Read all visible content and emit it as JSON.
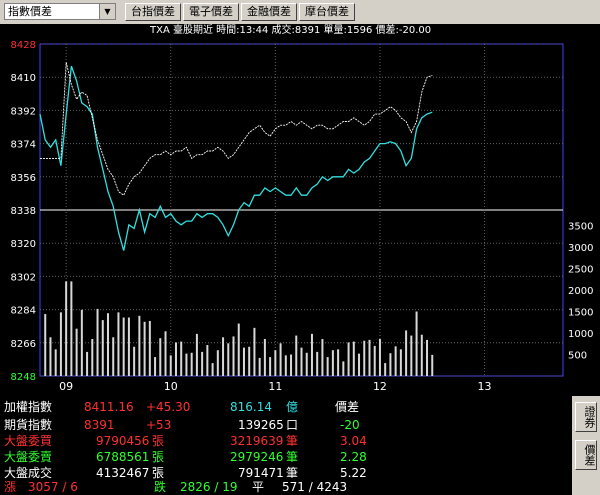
{
  "toolbar": {
    "selector_value": "指數價差",
    "buttons": [
      "台指價差",
      "電子價差",
      "金融價差",
      "摩台價差"
    ]
  },
  "chart": {
    "info_line": "TXA  臺股期近 時間:13:44 成交:8391 單量:1596 價差:-20.00",
    "colors": {
      "futures": "#30e0e0",
      "index": "#ffffff",
      "volume": "#d8d8d8",
      "grid": "#606060",
      "axis": "#4040ff"
    }
  },
  "chart_data": {
    "type": "line",
    "y_ticks": [
      "8428",
      "8410",
      "8392",
      "8374",
      "8356",
      "8338",
      "8320",
      "8302",
      "8284",
      "8266",
      "8248"
    ],
    "y_range": [
      8248,
      8428
    ],
    "reference_price": 8338,
    "volume_ticks": [
      "3500",
      "3000",
      "2500",
      "2000",
      "1500",
      "1000",
      "500"
    ],
    "volume_range": [
      0,
      4000
    ],
    "x_ticks": [
      "09",
      "10",
      "11",
      "12",
      "13"
    ],
    "session_minutes": [
      0,
      300
    ],
    "series": [
      {
        "name": "futures",
        "points": [
          [
            0,
            8390
          ],
          [
            3,
            8376
          ],
          [
            6,
            8372
          ],
          [
            9,
            8376
          ],
          [
            12,
            8362
          ],
          [
            15,
            8390
          ],
          [
            18,
            8416
          ],
          [
            21,
            8408
          ],
          [
            24,
            8396
          ],
          [
            27,
            8394
          ],
          [
            30,
            8390
          ],
          [
            33,
            8372
          ],
          [
            36,
            8360
          ],
          [
            39,
            8348
          ],
          [
            42,
            8340
          ],
          [
            45,
            8326
          ],
          [
            48,
            8316
          ],
          [
            51,
            8330
          ],
          [
            54,
            8328
          ],
          [
            57,
            8338
          ],
          [
            60,
            8326
          ],
          [
            63,
            8336
          ],
          [
            66,
            8334
          ],
          [
            69,
            8340
          ],
          [
            72,
            8334
          ],
          [
            75,
            8336
          ],
          [
            78,
            8332
          ],
          [
            81,
            8330
          ],
          [
            84,
            8332
          ],
          [
            87,
            8332
          ],
          [
            90,
            8336
          ],
          [
            93,
            8334
          ],
          [
            96,
            8336
          ],
          [
            99,
            8336
          ],
          [
            102,
            8334
          ],
          [
            105,
            8330
          ],
          [
            108,
            8324
          ],
          [
            111,
            8330
          ],
          [
            114,
            8338
          ],
          [
            117,
            8342
          ],
          [
            120,
            8340
          ],
          [
            123,
            8346
          ],
          [
            126,
            8346
          ],
          [
            129,
            8350
          ],
          [
            132,
            8348
          ],
          [
            135,
            8350
          ],
          [
            138,
            8348
          ],
          [
            141,
            8346
          ],
          [
            144,
            8346
          ],
          [
            147,
            8350
          ],
          [
            150,
            8346
          ],
          [
            153,
            8346
          ],
          [
            156,
            8350
          ],
          [
            159,
            8352
          ],
          [
            162,
            8356
          ],
          [
            165,
            8354
          ],
          [
            168,
            8356
          ],
          [
            171,
            8356
          ],
          [
            174,
            8356
          ],
          [
            177,
            8360
          ],
          [
            180,
            8358
          ],
          [
            183,
            8360
          ],
          [
            186,
            8364
          ],
          [
            189,
            8366
          ],
          [
            192,
            8370
          ],
          [
            195,
            8374
          ],
          [
            198,
            8374
          ],
          [
            201,
            8375
          ],
          [
            204,
            8374
          ],
          [
            207,
            8370
          ],
          [
            210,
            8362
          ],
          [
            213,
            8366
          ],
          [
            216,
            8382
          ],
          [
            219,
            8388
          ],
          [
            222,
            8390
          ],
          [
            225,
            8391
          ]
        ]
      },
      {
        "name": "index",
        "points": [
          [
            0,
            8366
          ],
          [
            3,
            8366
          ],
          [
            6,
            8366
          ],
          [
            9,
            8366
          ],
          [
            12,
            8366
          ],
          [
            15,
            8418
          ],
          [
            18,
            8406
          ],
          [
            21,
            8398
          ],
          [
            24,
            8402
          ],
          [
            27,
            8400
          ],
          [
            30,
            8388
          ],
          [
            33,
            8376
          ],
          [
            36,
            8368
          ],
          [
            39,
            8360
          ],
          [
            42,
            8356
          ],
          [
            45,
            8348
          ],
          [
            48,
            8346
          ],
          [
            51,
            8352
          ],
          [
            54,
            8356
          ],
          [
            57,
            8358
          ],
          [
            60,
            8362
          ],
          [
            63,
            8366
          ],
          [
            66,
            8368
          ],
          [
            69,
            8368
          ],
          [
            72,
            8370
          ],
          [
            75,
            8368
          ],
          [
            78,
            8370
          ],
          [
            81,
            8370
          ],
          [
            84,
            8372
          ],
          [
            87,
            8366
          ],
          [
            90,
            8368
          ],
          [
            93,
            8368
          ],
          [
            96,
            8370
          ],
          [
            99,
            8370
          ],
          [
            102,
            8372
          ],
          [
            105,
            8370
          ],
          [
            108,
            8366
          ],
          [
            111,
            8368
          ],
          [
            114,
            8372
          ],
          [
            117,
            8376
          ],
          [
            120,
            8380
          ],
          [
            123,
            8382
          ],
          [
            126,
            8384
          ],
          [
            129,
            8380
          ],
          [
            132,
            8378
          ],
          [
            135,
            8382
          ],
          [
            138,
            8384
          ],
          [
            141,
            8384
          ],
          [
            144,
            8386
          ],
          [
            147,
            8384
          ],
          [
            150,
            8386
          ],
          [
            153,
            8384
          ],
          [
            156,
            8382
          ],
          [
            159,
            8384
          ],
          [
            162,
            8384
          ],
          [
            165,
            8382
          ],
          [
            168,
            8382
          ],
          [
            171,
            8384
          ],
          [
            174,
            8386
          ],
          [
            177,
            8386
          ],
          [
            180,
            8388
          ],
          [
            183,
            8386
          ],
          [
            186,
            8384
          ],
          [
            189,
            8386
          ],
          [
            192,
            8390
          ],
          [
            195,
            8390
          ],
          [
            198,
            8392
          ],
          [
            201,
            8394
          ],
          [
            204,
            8392
          ],
          [
            207,
            8388
          ],
          [
            210,
            8386
          ],
          [
            213,
            8380
          ],
          [
            216,
            8386
          ],
          [
            219,
            8402
          ],
          [
            222,
            8410
          ],
          [
            225,
            8411
          ]
        ]
      }
    ]
  },
  "info": {
    "rows": [
      {
        "label": "加權指數",
        "value": "8411.16",
        "change": "+45.30",
        "amount": "816.14",
        "unit": "億",
        "title": "價差"
      },
      {
        "label": "期貨指數",
        "value": "8391",
        "change": "+53",
        "amount": "139265",
        "unit": "口",
        "title": "-20"
      },
      {
        "label": "大盤委買",
        "value": "9790456",
        "unit1": "張",
        "amount": "3219639",
        "unit2": "筆",
        "title": "3.04"
      },
      {
        "label": "大盤委賣",
        "value": "6788561",
        "unit1": "張",
        "amount": "2979246",
        "unit2": "筆",
        "title": "2.28"
      },
      {
        "label": "大盤成交",
        "value": "4132467",
        "unit1": "張",
        "amount": "791471",
        "unit2": "筆",
        "title": "5.22"
      }
    ],
    "breadth": {
      "up_label": "漲",
      "up_value": "3057 / 6",
      "down_label": "跌",
      "down_value": "2826 / 19",
      "flat_label": "平",
      "flat_value": "571 / 4243"
    }
  },
  "side": {
    "buttons": [
      "證券",
      "價差"
    ]
  }
}
